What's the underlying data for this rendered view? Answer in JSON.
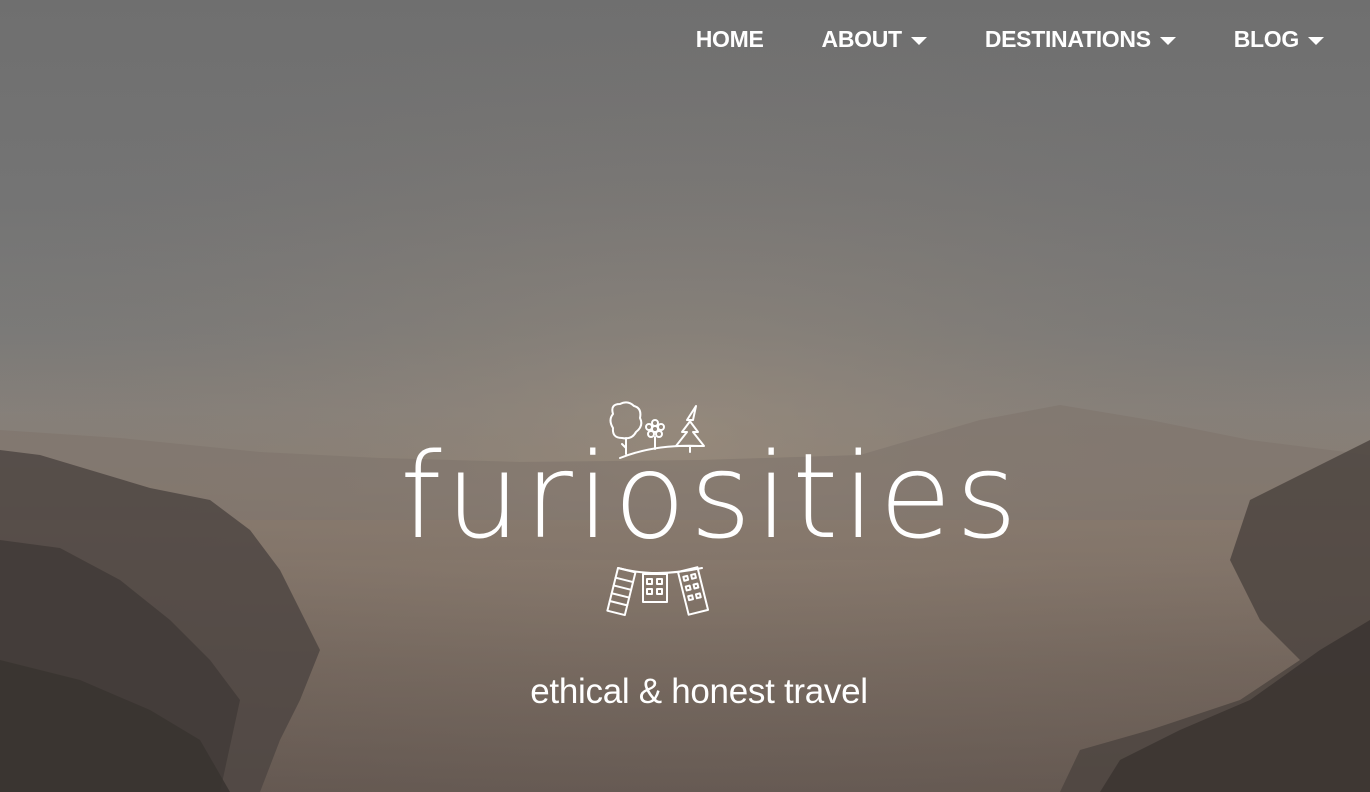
{
  "nav": {
    "items": [
      {
        "label": "HOME",
        "has_dropdown": false
      },
      {
        "label": "ABOUT",
        "has_dropdown": true
      },
      {
        "label": "DESTINATIONS",
        "has_dropdown": true
      },
      {
        "label": "BLOG",
        "has_dropdown": true
      }
    ]
  },
  "hero": {
    "background_description_colors": {
      "sky_top": "#6f6f6f",
      "horizon_glow": "#8a7e72",
      "mountains": "#4a4340"
    },
    "logo": {
      "wordmark": "furiosities",
      "top_icon": "trees-flower-icon",
      "bottom_icon": "bunting-houses-icon"
    },
    "tagline": "ethical & honest travel"
  },
  "colors": {
    "text": "#ffffff"
  }
}
